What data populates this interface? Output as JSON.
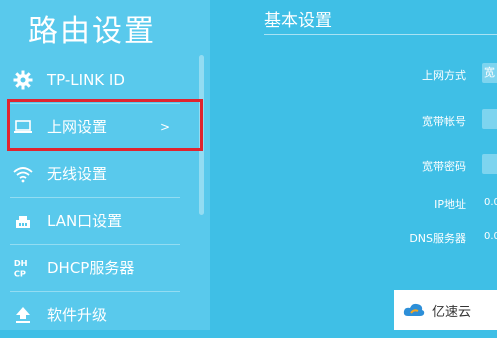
{
  "sidebar": {
    "title": "路由设置",
    "items": [
      {
        "label": "TP-LINK ID",
        "icon": "gear-icon"
      },
      {
        "label": "上网设置",
        "icon": "laptop-icon",
        "chevron": ">"
      },
      {
        "label": "无线设置",
        "icon": "wifi-icon"
      },
      {
        "label": "LAN口设置",
        "icon": "lan-icon"
      },
      {
        "label": "DHCP服务器",
        "icon": "dhcp-icon"
      },
      {
        "label": "软件升级",
        "icon": "upload-icon"
      }
    ]
  },
  "main": {
    "title": "基本设置",
    "fields": [
      {
        "label": "上网方式",
        "value": "宽"
      },
      {
        "label": "宽带帐号",
        "value": ""
      },
      {
        "label": "宽带密码",
        "value": ""
      },
      {
        "label": "IP地址",
        "value": "0.0"
      },
      {
        "label": "DNS服务器",
        "value": "0.0"
      }
    ]
  },
  "watermark": {
    "text": "亿速云",
    "icon": "cloud-logo-icon"
  },
  "colors": {
    "background": "#3fbfe6",
    "sidebar": "#59c9ec",
    "highlight": "#e0242f"
  }
}
